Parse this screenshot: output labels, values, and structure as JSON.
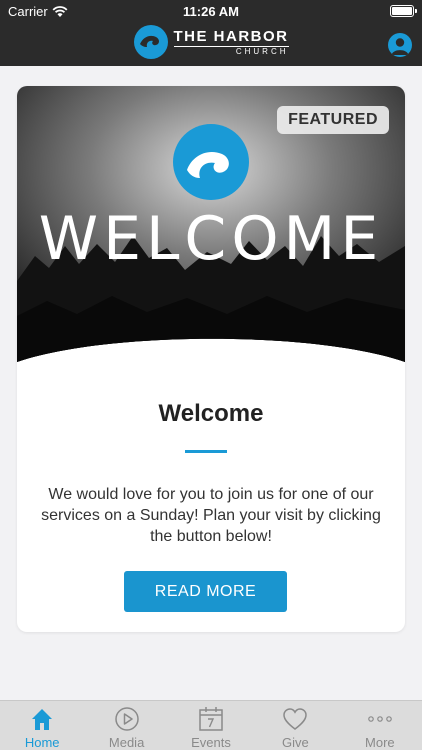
{
  "status_bar": {
    "carrier": "Carrier",
    "time": "11:26 AM"
  },
  "header": {
    "brand_line1": "THE HARBOR",
    "brand_line2": "CHURCH"
  },
  "card": {
    "badge": "FEATURED",
    "hero_text": "WELCOME",
    "title": "Welcome",
    "body": "We would love for you to join us for one of our services on a Sunday! Plan your visit by clicking the button below!",
    "button_label": "READ MORE"
  },
  "tabs": [
    {
      "label": "Home",
      "icon": "home-icon",
      "active": true
    },
    {
      "label": "Media",
      "icon": "play-icon",
      "active": false
    },
    {
      "label": "Events",
      "icon": "calendar-icon",
      "active": false
    },
    {
      "label": "Give",
      "icon": "heart-icon",
      "active": false
    },
    {
      "label": "More",
      "icon": "more-icon",
      "active": false
    }
  ],
  "colors": {
    "accent": "#1a9ad6",
    "header_bg": "#2b2b2b",
    "button": "#1a95cf"
  }
}
